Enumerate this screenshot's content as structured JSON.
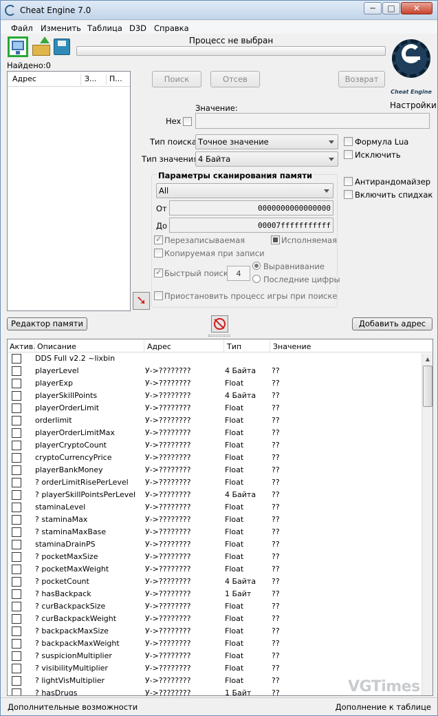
{
  "window": {
    "title": "Cheat Engine 7.0",
    "minimize": "─",
    "maximize": "□",
    "close": "✕"
  },
  "menu": [
    "Файл",
    "Изменить",
    "Таблица",
    "D3D",
    "Справка"
  ],
  "toolbar": {
    "process_label": "Процесс не выбран",
    "icons": [
      "open-process-icon",
      "open-file-icon",
      "save-file-icon"
    ],
    "highlight_color": "#25a835"
  },
  "logo": {
    "text": "Cheat Engine"
  },
  "settings_label": "Настройки",
  "found_label": "Найдено:0",
  "address_list": {
    "headers": [
      "Адрес",
      "З...",
      "П..."
    ]
  },
  "scan_buttons": {
    "search": "Поиск",
    "filter": "Отсев",
    "undo": "Возврат"
  },
  "value": {
    "label": "Значение:",
    "hex_label": "Hex",
    "value": ""
  },
  "scan_type": {
    "label": "Тип поиска",
    "selected": "Точное значение"
  },
  "value_type": {
    "label": "Тип значения",
    "selected": "4 Байта"
  },
  "right_options": {
    "lua_formula": "Формула Lua",
    "not": "Исключить",
    "unrandomizer": "Антирандомайзер",
    "speedhack": "Включить спидхак"
  },
  "memory_scan": {
    "title": "Параметры сканирования памяти",
    "region": "All",
    "from_label": "От",
    "from": "0000000000000000",
    "to_label": "До",
    "to": "00007fffffffffff",
    "writable": "Перезаписываемая",
    "executable": "Исполняемая",
    "copy_on_write": "Копируемая при записи",
    "fast_scan": "Быстрый поиск",
    "fast_scan_value": "4",
    "alignment": "Выравнивание",
    "last_digits": "Последние цифры",
    "pause": "Приостановить процесс игры при поиске"
  },
  "memory_viewer_button": "Редактор памяти",
  "add_address_button": "Добавить адрес",
  "cheat_table": {
    "headers": [
      "Актив.",
      "Описание",
      "Адрес",
      "Тип",
      "Значение"
    ],
    "rows": [
      {
        "desc": "DDS Full v2.2 ~lixbin",
        "addr": "",
        "type": "",
        "value": "",
        "checkbox": false
      },
      {
        "desc": "playerLevel",
        "addr": "У->????????",
        "type": "4 Байта",
        "value": "??",
        "checkbox": true
      },
      {
        "desc": "playerExp",
        "addr": "У->????????",
        "type": "Float",
        "value": "??",
        "checkbox": true
      },
      {
        "desc": "playerSkillPoints",
        "addr": "У->????????",
        "type": "4 Байта",
        "value": "??",
        "checkbox": true
      },
      {
        "desc": "playerOrderLimit",
        "addr": "У->????????",
        "type": "Float",
        "value": "??",
        "checkbox": true
      },
      {
        "desc": "orderlimit",
        "addr": "У->????????",
        "type": "Float",
        "value": "??",
        "checkbox": true
      },
      {
        "desc": "playerOrderLimitMax",
        "addr": "У->????????",
        "type": "Float",
        "value": "??",
        "checkbox": true
      },
      {
        "desc": "playerCryptoCount",
        "addr": "У->????????",
        "type": "Float",
        "value": "??",
        "checkbox": true
      },
      {
        "desc": "cryptoCurrencyPrice",
        "addr": "У->????????",
        "type": "Float",
        "value": "??",
        "checkbox": true
      },
      {
        "desc": "playerBankMoney",
        "addr": "У->????????",
        "type": "Float",
        "value": "??",
        "checkbox": true
      },
      {
        "desc": "? orderLimitRisePerLevel",
        "addr": "У->????????",
        "type": "Float",
        "value": "??",
        "checkbox": true
      },
      {
        "desc": "? playerSkillPointsPerLevel",
        "addr": "У->????????",
        "type": "4 Байта",
        "value": "??",
        "checkbox": true
      },
      {
        "desc": "staminaLevel",
        "addr": "У->????????",
        "type": "Float",
        "value": "??",
        "checkbox": true
      },
      {
        "desc": "? staminaMax",
        "addr": "У->????????",
        "type": "Float",
        "value": "??",
        "checkbox": true
      },
      {
        "desc": "? staminaMaxBase",
        "addr": "У->????????",
        "type": "Float",
        "value": "??",
        "checkbox": true
      },
      {
        "desc": "staminaDrainPS",
        "addr": "У->????????",
        "type": "Float",
        "value": "??",
        "checkbox": true
      },
      {
        "desc": "? pocketMaxSize",
        "addr": "У->????????",
        "type": "Float",
        "value": "??",
        "checkbox": true
      },
      {
        "desc": "? pocketMaxWeight",
        "addr": "У->????????",
        "type": "Float",
        "value": "??",
        "checkbox": true
      },
      {
        "desc": "? pocketCount",
        "addr": "У->????????",
        "type": "4 Байта",
        "value": "??",
        "checkbox": true
      },
      {
        "desc": "? hasBackpack",
        "addr": "У->????????",
        "type": "1 Байт",
        "value": "??",
        "checkbox": true
      },
      {
        "desc": "? curBackpackSize",
        "addr": "У->????????",
        "type": "Float",
        "value": "??",
        "checkbox": true
      },
      {
        "desc": "? curBackpackWeight",
        "addr": "У->????????",
        "type": "Float",
        "value": "??",
        "checkbox": true
      },
      {
        "desc": "? backpackMaxSize",
        "addr": "У->????????",
        "type": "Float",
        "value": "??",
        "checkbox": true
      },
      {
        "desc": "? backpackMaxWeight",
        "addr": "У->????????",
        "type": "Float",
        "value": "??",
        "checkbox": true
      },
      {
        "desc": "? suspicionMultiplier",
        "addr": "У->????????",
        "type": "Float",
        "value": "??",
        "checkbox": true
      },
      {
        "desc": "? visibilityMultiplier",
        "addr": "У->????????",
        "type": "Float",
        "value": "??",
        "checkbox": true
      },
      {
        "desc": "? lightVisMultiplier",
        "addr": "У->????????",
        "type": "Float",
        "value": "??",
        "checkbox": true
      },
      {
        "desc": "? hasDrugs",
        "addr": "У->????????",
        "type": "1 Байт",
        "value": "??",
        "checkbox": true
      }
    ]
  },
  "watermark": "VGTimes",
  "status": {
    "advanced_options": "Дополнительные возможности",
    "table_extras": "Дополнение к таблице"
  }
}
